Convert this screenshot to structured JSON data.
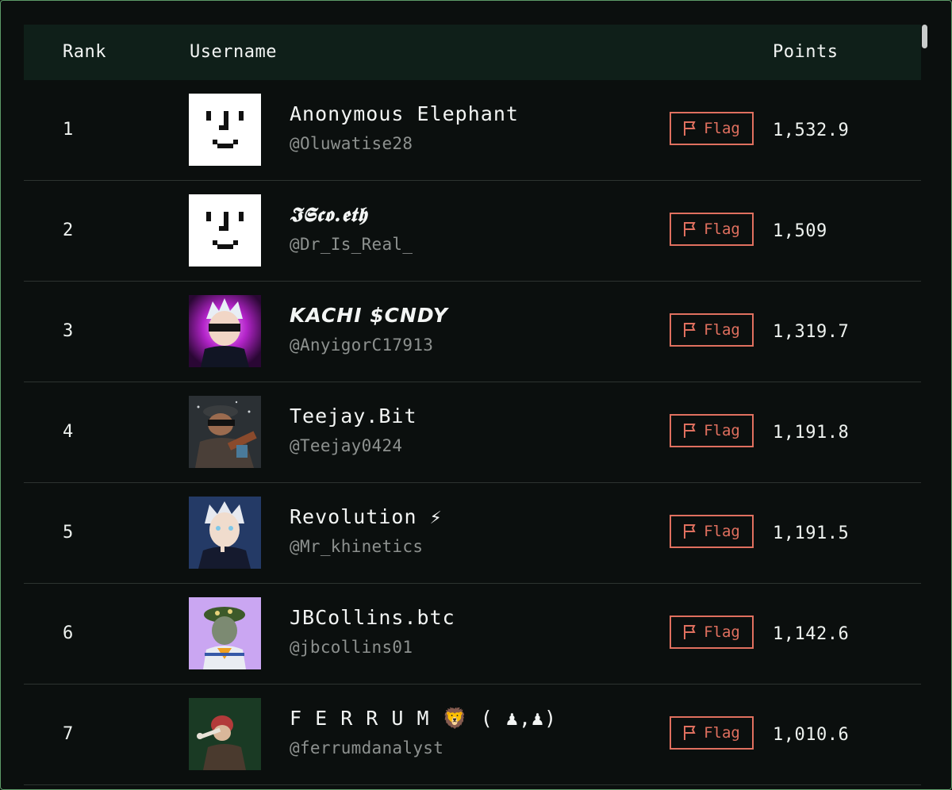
{
  "header": {
    "rank_label": "Rank",
    "username_label": "Username",
    "points_label": "Points"
  },
  "flag_label": "Flag",
  "colors": {
    "background": "#0b0f0e",
    "header_bg": "#0f1f19",
    "flag_accent": "#e0705f",
    "handle_text": "#8d918f",
    "frame_border": "#5d9a68"
  },
  "rows": [
    {
      "rank": "1",
      "name": "Anonymous Elephant",
      "handle": "@Oluwatise28",
      "points": "1,532.9",
      "avatar_icon": "smiley-face-icon"
    },
    {
      "rank": "2",
      "name": "𝕴𝕾𝖈𝖔.𝖊𝖙𝖍",
      "handle": "@Dr_Is_Real_",
      "points": "1,509",
      "avatar_icon": "smiley-face-icon"
    },
    {
      "rank": "3",
      "name": "KACHI $CNDY",
      "handle": "@AnyigorC17913",
      "points": "1,319.7",
      "avatar_icon": "anime-avatar-icon"
    },
    {
      "rank": "4",
      "name": "Teejay.Bit",
      "handle": "@Teejay0424",
      "points": "1,191.8",
      "avatar_icon": "character-avatar-icon"
    },
    {
      "rank": "5",
      "name": "Revolution ⚡",
      "handle": "@Mr_khinetics",
      "points": "1,191.5",
      "avatar_icon": "anime-avatar-icon"
    },
    {
      "rank": "6",
      "name": "JBCollins.btc",
      "handle": "@jbcollins01",
      "points": "1,142.6",
      "avatar_icon": "nft-avatar-icon"
    },
    {
      "rank": "7",
      "name": "F E R R U M 🦁 ( ♟,♟)",
      "handle": "@ferrumdanalyst",
      "points": "1,010.6",
      "avatar_icon": "nft-avatar-icon"
    }
  ]
}
